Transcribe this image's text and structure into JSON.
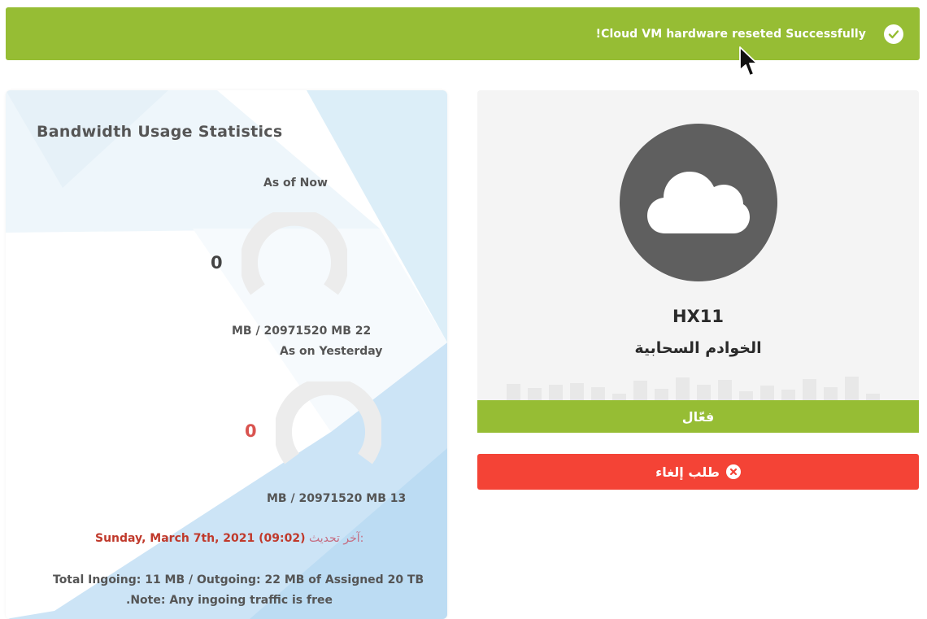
{
  "alert": {
    "message": "!Cloud VM hardware reseted Successfully",
    "icon": "check-circle-icon",
    "color": "#96bd34"
  },
  "stats": {
    "title": "Bandwidth Usage Statistics",
    "now": {
      "label": "As of Now",
      "value": "0",
      "usage": "MB / 20971520 MB 22",
      "value_color": "#444444"
    },
    "yesterday": {
      "label": "As on Yesterday",
      "value": "0",
      "usage": "MB / 20971520 MB 13",
      "value_color": "#d9534f"
    },
    "updated_label": "آخر تحديث:",
    "updated_value": "Sunday, March 7th, 2021 (09:02)",
    "total": "Total Ingoing: 11 MB / Outgoing: 22 MB of Assigned 20 TB",
    "note": ".Note: Any ingoing traffic is free"
  },
  "server": {
    "icon": "cloud-icon",
    "hostname": "HX11",
    "product": "الخوادم السحابية",
    "status": "فعّال",
    "status_color": "#96bd34",
    "cancel_label": "طلب إلغاء",
    "cancel_icon": "x-circle-icon",
    "cancel_color": "#f44336"
  }
}
